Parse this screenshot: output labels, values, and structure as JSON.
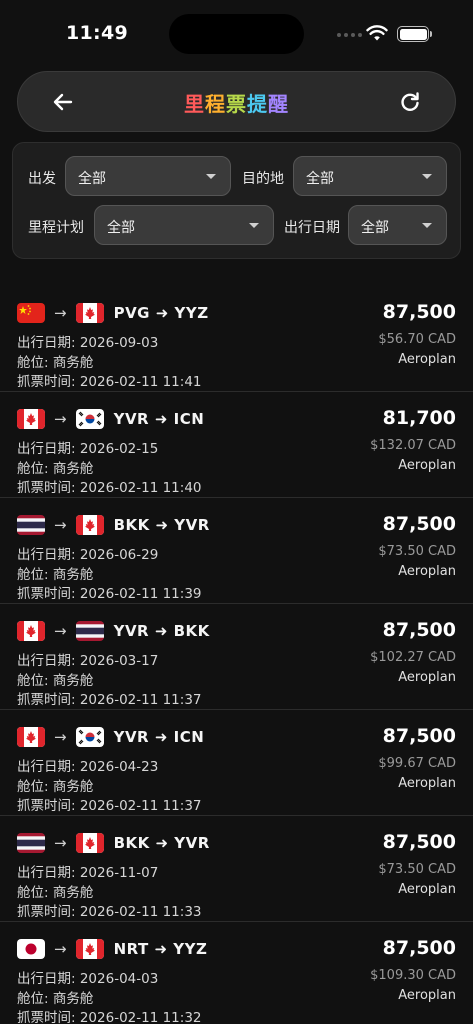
{
  "status_bar": {
    "time": "11:49"
  },
  "header": {
    "title_chars": [
      "里",
      "程",
      "票",
      "提",
      "醒"
    ],
    "title_colors": [
      "#ff5a5a",
      "#ffb02e",
      "#b7d94a",
      "#4cc9f0",
      "#a385ff"
    ],
    "back_icon": "arrow-left-icon",
    "refresh_icon": "refresh-icon"
  },
  "filters": {
    "origin": {
      "label": "出发",
      "value": "全部"
    },
    "destination": {
      "label": "目的地",
      "value": "全部"
    },
    "program": {
      "label": "里程计划",
      "value": "全部"
    },
    "date": {
      "label": "出行日期",
      "value": "全部"
    }
  },
  "tickets": [
    {
      "from_flag": "cn",
      "to_flag": "ca",
      "codes": "PVG ➜ YYZ",
      "date": "出行日期: 2026-09-03",
      "cabin": "舱位: 商务舱",
      "fetched": "抓票时间: 2026-02-11 11:41",
      "points": "87,500",
      "price": "$56.70 CAD",
      "program": "Aeroplan"
    },
    {
      "from_flag": "ca",
      "to_flag": "kr",
      "codes": "YVR ➜ ICN",
      "date": "出行日期: 2026-02-15",
      "cabin": "舱位: 商务舱",
      "fetched": "抓票时间: 2026-02-11 11:40",
      "points": "81,700",
      "price": "$132.07 CAD",
      "program": "Aeroplan"
    },
    {
      "from_flag": "th",
      "to_flag": "ca",
      "codes": "BKK ➜ YVR",
      "date": "出行日期: 2026-06-29",
      "cabin": "舱位: 商务舱",
      "fetched": "抓票时间: 2026-02-11 11:39",
      "points": "87,500",
      "price": "$73.50 CAD",
      "program": "Aeroplan"
    },
    {
      "from_flag": "ca",
      "to_flag": "th",
      "codes": "YVR ➜ BKK",
      "date": "出行日期: 2026-03-17",
      "cabin": "舱位: 商务舱",
      "fetched": "抓票时间: 2026-02-11 11:37",
      "points": "87,500",
      "price": "$102.27 CAD",
      "program": "Aeroplan"
    },
    {
      "from_flag": "ca",
      "to_flag": "kr",
      "codes": "YVR ➜ ICN",
      "date": "出行日期: 2026-04-23",
      "cabin": "舱位: 商务舱",
      "fetched": "抓票时间: 2026-02-11 11:37",
      "points": "87,500",
      "price": "$99.67 CAD",
      "program": "Aeroplan"
    },
    {
      "from_flag": "th",
      "to_flag": "ca",
      "codes": "BKK ➜ YVR",
      "date": "出行日期: 2026-11-07",
      "cabin": "舱位: 商务舱",
      "fetched": "抓票时间: 2026-02-11 11:33",
      "points": "87,500",
      "price": "$73.50 CAD",
      "program": "Aeroplan"
    },
    {
      "from_flag": "jp",
      "to_flag": "ca",
      "codes": "NRT ➜ YYZ",
      "date": "出行日期: 2026-04-03",
      "cabin": "舱位: 商务舱",
      "fetched": "抓票时间: 2026-02-11 11:32",
      "points": "87,500",
      "price": "$109.30 CAD",
      "program": "Aeroplan"
    }
  ]
}
